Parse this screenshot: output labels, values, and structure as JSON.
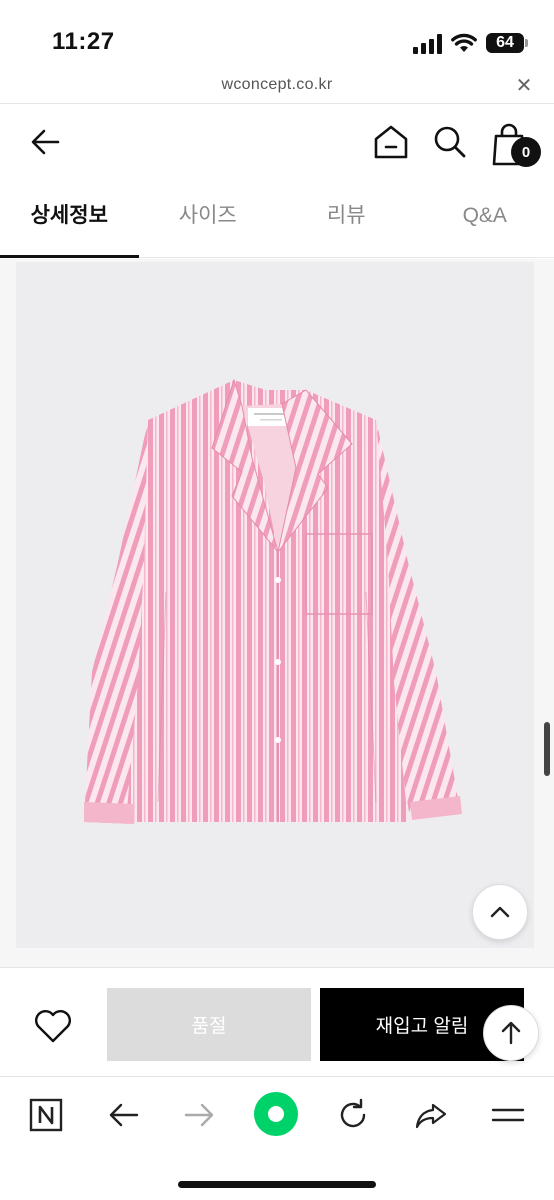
{
  "status_bar": {
    "time": "11:27",
    "battery": "64"
  },
  "browser": {
    "url": "wconcept.co.kr"
  },
  "header": {
    "cart_count": "0"
  },
  "tabs": [
    {
      "label": "상세정보",
      "active": true
    },
    {
      "label": "사이즈",
      "active": false
    },
    {
      "label": "리뷰",
      "active": false
    },
    {
      "label": "Q&A",
      "active": false
    }
  ],
  "purchase": {
    "soldout_label": "품절",
    "restock_label": "재입고 알림"
  },
  "colors": {
    "accent_green": "#00d26a",
    "shirt_pink": "#f2a3bf",
    "button_black": "#000000",
    "soldout_gray": "#dcdcdc"
  },
  "icons": [
    "back-arrow-icon",
    "home-icon",
    "search-icon",
    "cart-icon",
    "heart-icon",
    "chevron-up-icon",
    "arrow-up-icon",
    "naver-n-icon",
    "browser-back-icon",
    "browser-forward-icon",
    "green-dot-icon",
    "refresh-icon",
    "share-icon",
    "menu-icon"
  ]
}
